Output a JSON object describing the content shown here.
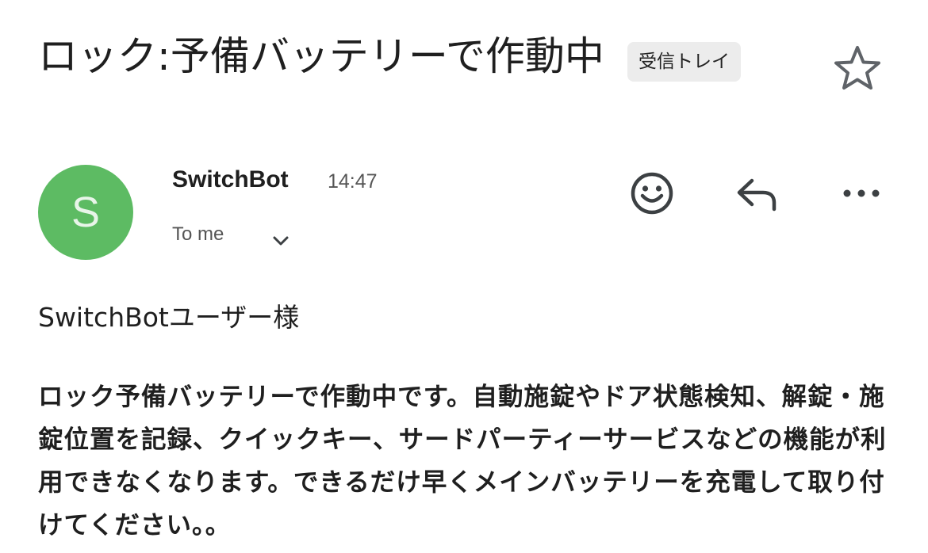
{
  "subject": "ロック:予備バッテリーで作動中",
  "label": "受信トレイ",
  "icons": {
    "star": "star-outline-icon",
    "chevron": "chevron-down-icon",
    "emoji": "smiley-icon",
    "reply": "reply-icon",
    "more": "more-horiz-icon"
  },
  "sender": {
    "avatar_letter": "S",
    "avatar_color": "#5dbb63",
    "name": "SwitchBot",
    "time": "14:47",
    "recipient": "To me"
  },
  "message": {
    "greeting": "SwitchBotユーザー様",
    "body": "ロック予備バッテリーで作動中です。自動施錠やドア状態検知、解錠・施錠位置を記録、クイックキー、サードパーティーサービスなどの機能が利用できなくなります。できるだけ早くメインバッテリーを充電して取り付けてください。。"
  }
}
